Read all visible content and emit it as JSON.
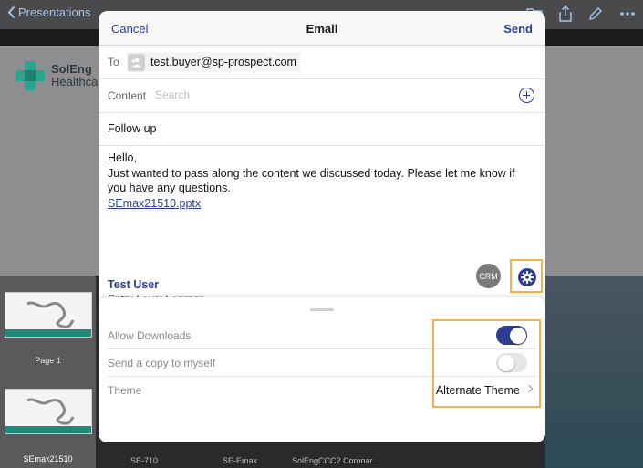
{
  "background": {
    "back_label": "Presentations",
    "logo_line1": "SolEng",
    "logo_line2": "Healthca",
    "thumbnails": [
      {
        "label": "Page 1"
      },
      {
        "label": "SEmax21510"
      }
    ],
    "bottom_labels": [
      "SE-710",
      "SE-Emax",
      "SolEngCCC2 Coronar..."
    ]
  },
  "email": {
    "title": "Email",
    "cancel_label": "Cancel",
    "send_label": "Send",
    "to_label": "To",
    "recipient": "test.buyer@sp-prospect.com",
    "content_label": "Content",
    "content_placeholder": "Search",
    "subject": "Follow up",
    "body_lines": [
      "Hello,",
      "Just wanted to pass along the content we discussed today. Please let me know if you have any questions."
    ],
    "attachment": "SEmax21510.pptx",
    "signature_name": "Test User",
    "signature_sub": "Entry Level Learner",
    "crm_label": "CRM"
  },
  "settings": {
    "allow_downloads_label": "Allow Downloads",
    "allow_downloads": true,
    "copy_to_self_label": "Send a copy to myself",
    "copy_to_self": false,
    "theme_label": "Theme",
    "theme_value": "Alternate Theme"
  },
  "colors": {
    "accent": "#2c3e8f",
    "highlight": "#f0b44c"
  }
}
